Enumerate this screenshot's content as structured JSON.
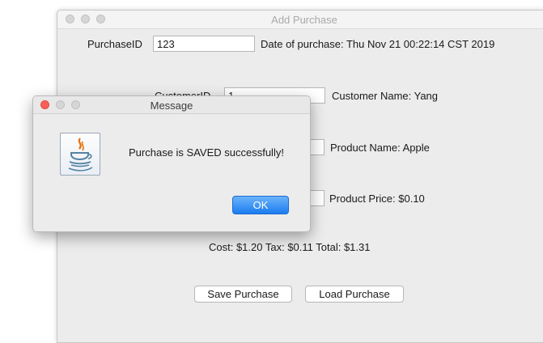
{
  "main_window": {
    "title": "Add Purchase",
    "purchase_id_label": "PurchaseID",
    "purchase_id_value": "123",
    "date_label": "Date of purchase: Thu Nov 21 00:22:14 CST 2019",
    "customer_id_label": "CustomerID",
    "customer_id_value": "1",
    "customer_name": "Customer Name: Yang",
    "product_name": "Product Name: Apple",
    "product_price": "Product Price: $0.10",
    "totals": "Cost: $1.20 Tax: $0.11 Total: $1.31",
    "save_button": "Save Purchase",
    "load_button": "Load Purchase"
  },
  "dialog": {
    "title": "Message",
    "message": "Purchase is SAVED successfully!",
    "ok_button": "OK",
    "icon": "java-coffee-cup-icon"
  },
  "colors": {
    "ok_button": "#1b7cf0",
    "close_button": "#fc5f57",
    "window_bg": "#ececec"
  }
}
